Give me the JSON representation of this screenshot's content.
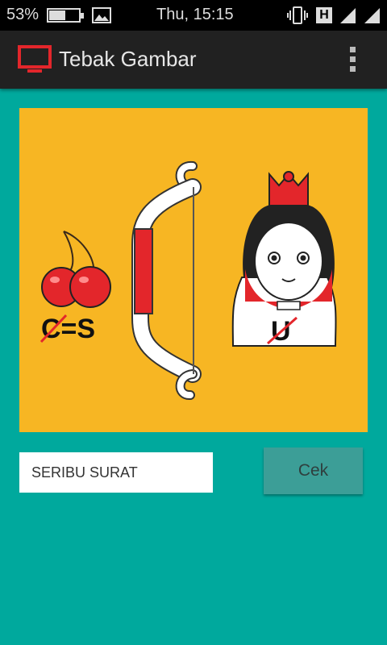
{
  "status_bar": {
    "battery_percent": "53%",
    "battery_level": 0.53,
    "clock": "Thu, 15:15",
    "network_label": "H",
    "icons": [
      "battery-icon",
      "gallery-icon",
      "vibrate-icon",
      "h-network-icon",
      "signal-icon"
    ]
  },
  "app_bar": {
    "title": "Tebak Gambar",
    "app_icon": "tv-icon",
    "menu_icon": "overflow-menu-icon"
  },
  "puzzle": {
    "cherry_rebus": "C=S",
    "princess_rebus": "U"
  },
  "answer": {
    "value": "SERIBU SURAT"
  },
  "check_button": {
    "label": "Cek"
  },
  "colors": {
    "background": "#00a99d",
    "app_bar": "#212121",
    "puzzle_bg": "#f7b623",
    "accent_red": "#e3262b",
    "button": "#3c9e97"
  }
}
